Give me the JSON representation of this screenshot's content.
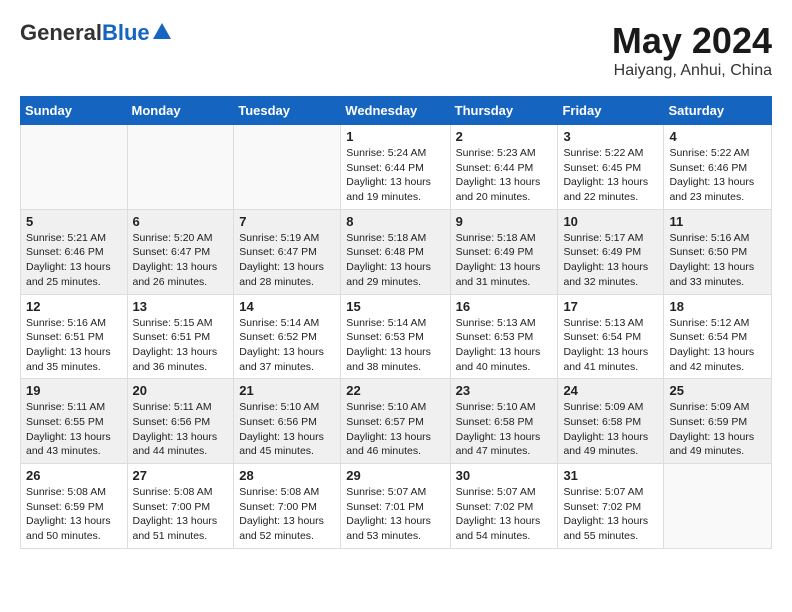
{
  "header": {
    "logo_general": "General",
    "logo_blue": "Blue",
    "month": "May 2024",
    "location": "Haiyang, Anhui, China"
  },
  "days_of_week": [
    "Sunday",
    "Monday",
    "Tuesday",
    "Wednesday",
    "Thursday",
    "Friday",
    "Saturday"
  ],
  "weeks": [
    [
      {
        "day": "",
        "info": ""
      },
      {
        "day": "",
        "info": ""
      },
      {
        "day": "",
        "info": ""
      },
      {
        "day": "1",
        "info": "Sunrise: 5:24 AM\nSunset: 6:44 PM\nDaylight: 13 hours and 19 minutes."
      },
      {
        "day": "2",
        "info": "Sunrise: 5:23 AM\nSunset: 6:44 PM\nDaylight: 13 hours and 20 minutes."
      },
      {
        "day": "3",
        "info": "Sunrise: 5:22 AM\nSunset: 6:45 PM\nDaylight: 13 hours and 22 minutes."
      },
      {
        "day": "4",
        "info": "Sunrise: 5:22 AM\nSunset: 6:46 PM\nDaylight: 13 hours and 23 minutes."
      }
    ],
    [
      {
        "day": "5",
        "info": "Sunrise: 5:21 AM\nSunset: 6:46 PM\nDaylight: 13 hours and 25 minutes."
      },
      {
        "day": "6",
        "info": "Sunrise: 5:20 AM\nSunset: 6:47 PM\nDaylight: 13 hours and 26 minutes."
      },
      {
        "day": "7",
        "info": "Sunrise: 5:19 AM\nSunset: 6:47 PM\nDaylight: 13 hours and 28 minutes."
      },
      {
        "day": "8",
        "info": "Sunrise: 5:18 AM\nSunset: 6:48 PM\nDaylight: 13 hours and 29 minutes."
      },
      {
        "day": "9",
        "info": "Sunrise: 5:18 AM\nSunset: 6:49 PM\nDaylight: 13 hours and 31 minutes."
      },
      {
        "day": "10",
        "info": "Sunrise: 5:17 AM\nSunset: 6:49 PM\nDaylight: 13 hours and 32 minutes."
      },
      {
        "day": "11",
        "info": "Sunrise: 5:16 AM\nSunset: 6:50 PM\nDaylight: 13 hours and 33 minutes."
      }
    ],
    [
      {
        "day": "12",
        "info": "Sunrise: 5:16 AM\nSunset: 6:51 PM\nDaylight: 13 hours and 35 minutes."
      },
      {
        "day": "13",
        "info": "Sunrise: 5:15 AM\nSunset: 6:51 PM\nDaylight: 13 hours and 36 minutes."
      },
      {
        "day": "14",
        "info": "Sunrise: 5:14 AM\nSunset: 6:52 PM\nDaylight: 13 hours and 37 minutes."
      },
      {
        "day": "15",
        "info": "Sunrise: 5:14 AM\nSunset: 6:53 PM\nDaylight: 13 hours and 38 minutes."
      },
      {
        "day": "16",
        "info": "Sunrise: 5:13 AM\nSunset: 6:53 PM\nDaylight: 13 hours and 40 minutes."
      },
      {
        "day": "17",
        "info": "Sunrise: 5:13 AM\nSunset: 6:54 PM\nDaylight: 13 hours and 41 minutes."
      },
      {
        "day": "18",
        "info": "Sunrise: 5:12 AM\nSunset: 6:54 PM\nDaylight: 13 hours and 42 minutes."
      }
    ],
    [
      {
        "day": "19",
        "info": "Sunrise: 5:11 AM\nSunset: 6:55 PM\nDaylight: 13 hours and 43 minutes."
      },
      {
        "day": "20",
        "info": "Sunrise: 5:11 AM\nSunset: 6:56 PM\nDaylight: 13 hours and 44 minutes."
      },
      {
        "day": "21",
        "info": "Sunrise: 5:10 AM\nSunset: 6:56 PM\nDaylight: 13 hours and 45 minutes."
      },
      {
        "day": "22",
        "info": "Sunrise: 5:10 AM\nSunset: 6:57 PM\nDaylight: 13 hours and 46 minutes."
      },
      {
        "day": "23",
        "info": "Sunrise: 5:10 AM\nSunset: 6:58 PM\nDaylight: 13 hours and 47 minutes."
      },
      {
        "day": "24",
        "info": "Sunrise: 5:09 AM\nSunset: 6:58 PM\nDaylight: 13 hours and 49 minutes."
      },
      {
        "day": "25",
        "info": "Sunrise: 5:09 AM\nSunset: 6:59 PM\nDaylight: 13 hours and 49 minutes."
      }
    ],
    [
      {
        "day": "26",
        "info": "Sunrise: 5:08 AM\nSunset: 6:59 PM\nDaylight: 13 hours and 50 minutes."
      },
      {
        "day": "27",
        "info": "Sunrise: 5:08 AM\nSunset: 7:00 PM\nDaylight: 13 hours and 51 minutes."
      },
      {
        "day": "28",
        "info": "Sunrise: 5:08 AM\nSunset: 7:00 PM\nDaylight: 13 hours and 52 minutes."
      },
      {
        "day": "29",
        "info": "Sunrise: 5:07 AM\nSunset: 7:01 PM\nDaylight: 13 hours and 53 minutes."
      },
      {
        "day": "30",
        "info": "Sunrise: 5:07 AM\nSunset: 7:02 PM\nDaylight: 13 hours and 54 minutes."
      },
      {
        "day": "31",
        "info": "Sunrise: 5:07 AM\nSunset: 7:02 PM\nDaylight: 13 hours and 55 minutes."
      },
      {
        "day": "",
        "info": ""
      }
    ]
  ]
}
